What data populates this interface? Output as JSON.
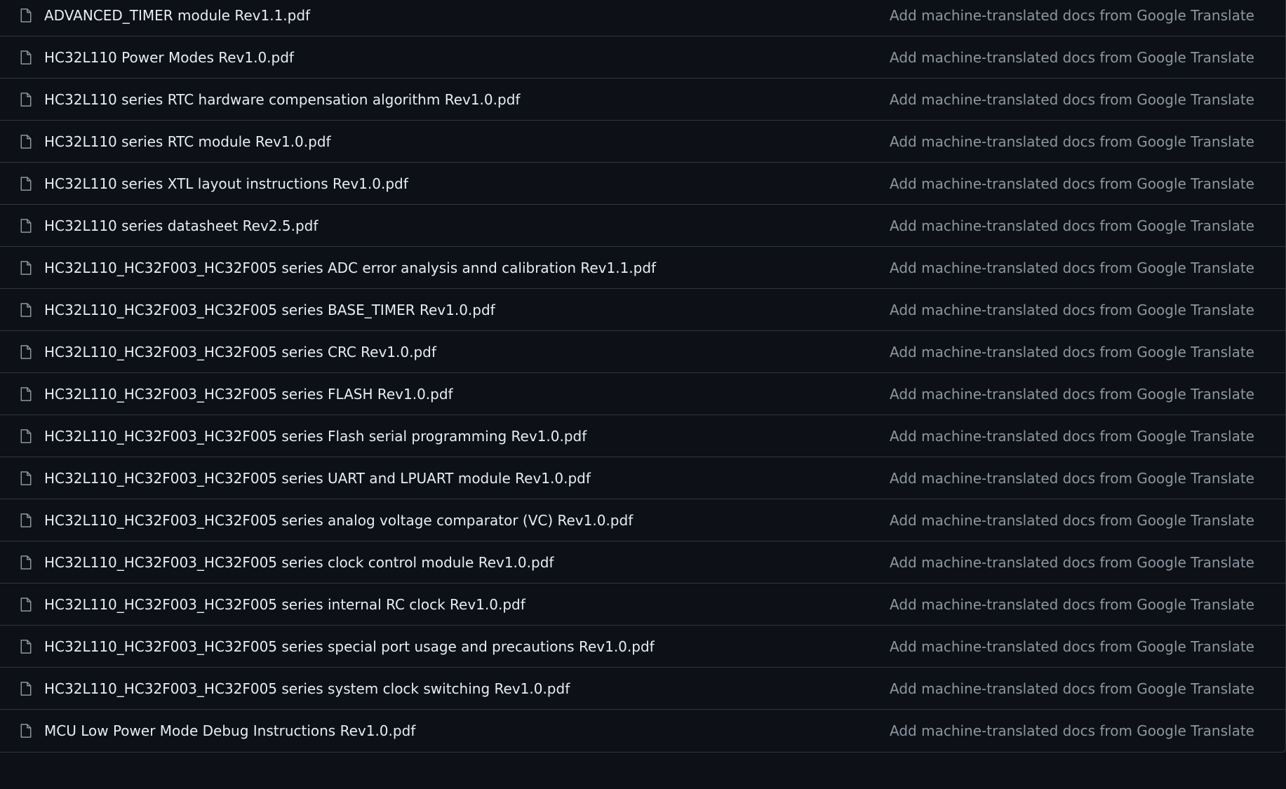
{
  "files": [
    {
      "icon": "file-icon",
      "name": "ADVANCED_TIMER module Rev1.1.pdf",
      "commit": "Add machine-translated docs from Google Translate"
    },
    {
      "icon": "file-icon",
      "name": "HC32L110 Power Modes Rev1.0.pdf",
      "commit": "Add machine-translated docs from Google Translate"
    },
    {
      "icon": "file-icon",
      "name": "HC32L110 series RTC hardware compensation algorithm Rev1.0.pdf",
      "commit": "Add machine-translated docs from Google Translate"
    },
    {
      "icon": "file-icon",
      "name": "HC32L110 series RTC module Rev1.0.pdf",
      "commit": "Add machine-translated docs from Google Translate"
    },
    {
      "icon": "file-icon",
      "name": "HC32L110 series XTL layout instructions Rev1.0.pdf",
      "commit": "Add machine-translated docs from Google Translate"
    },
    {
      "icon": "file-icon",
      "name": "HC32L110 series datasheet Rev2.5.pdf",
      "commit": "Add machine-translated docs from Google Translate"
    },
    {
      "icon": "file-icon",
      "name": "HC32L110_HC32F003_HC32F005 series ADC error analysis annd calibration Rev1.1.pdf",
      "commit": "Add machine-translated docs from Google Translate"
    },
    {
      "icon": "file-icon",
      "name": "HC32L110_HC32F003_HC32F005 series BASE_TIMER Rev1.0.pdf",
      "commit": "Add machine-translated docs from Google Translate"
    },
    {
      "icon": "file-icon",
      "name": "HC32L110_HC32F003_HC32F005 series CRC Rev1.0.pdf",
      "commit": "Add machine-translated docs from Google Translate"
    },
    {
      "icon": "file-icon",
      "name": "HC32L110_HC32F003_HC32F005 series FLASH Rev1.0.pdf",
      "commit": "Add machine-translated docs from Google Translate"
    },
    {
      "icon": "file-icon",
      "name": "HC32L110_HC32F003_HC32F005 series Flash serial programming Rev1.0.pdf",
      "commit": "Add machine-translated docs from Google Translate"
    },
    {
      "icon": "file-icon",
      "name": "HC32L110_HC32F003_HC32F005 series UART and LPUART module Rev1.0.pdf",
      "commit": "Add machine-translated docs from Google Translate"
    },
    {
      "icon": "file-icon",
      "name": "HC32L110_HC32F003_HC32F005 series analog voltage comparator (VC) Rev1.0.pdf",
      "commit": "Add machine-translated docs from Google Translate"
    },
    {
      "icon": "file-icon",
      "name": "HC32L110_HC32F003_HC32F005 series clock control module Rev1.0.pdf",
      "commit": "Add machine-translated docs from Google Translate"
    },
    {
      "icon": "file-icon",
      "name": "HC32L110_HC32F003_HC32F005 series internal RC clock Rev1.0.pdf",
      "commit": "Add machine-translated docs from Google Translate"
    },
    {
      "icon": "file-icon",
      "name": "HC32L110_HC32F003_HC32F005 series special port usage and precautions Rev1.0.pdf",
      "commit": "Add machine-translated docs from Google Translate"
    },
    {
      "icon": "file-icon",
      "name": "HC32L110_HC32F003_HC32F005 series system clock switching Rev1.0.pdf",
      "commit": "Add machine-translated docs from Google Translate"
    },
    {
      "icon": "file-icon",
      "name": "MCU Low Power Mode Debug Instructions Rev1.0.pdf",
      "commit": "Add machine-translated docs from Google Translate"
    }
  ],
  "colors": {
    "background": "#0d1117",
    "border": "#30363d",
    "file_name": "#e6edf3",
    "commit_message": "#8d96a0",
    "icon": "#8d96a0"
  }
}
